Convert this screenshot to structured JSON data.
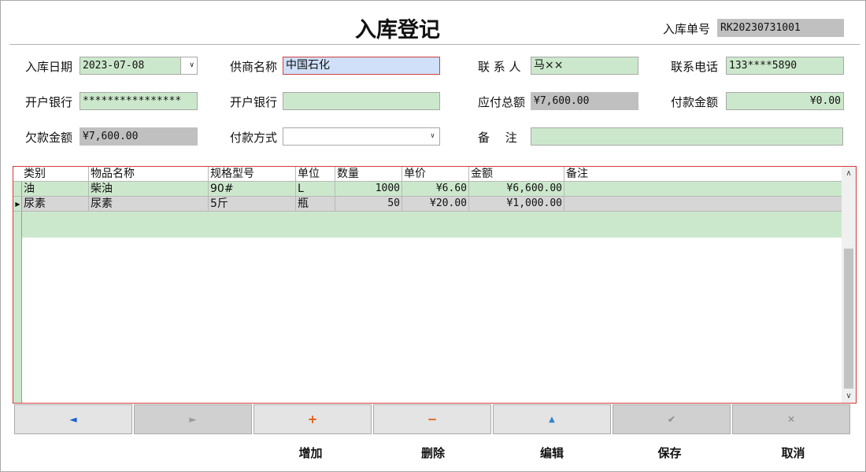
{
  "form": {
    "title": "入库登记",
    "order_no_label": "入库单号",
    "order_no": "RK20230731001",
    "date_label": "入库日期",
    "date_value": "2023-07-08",
    "supplier_label": "供商名称",
    "supplier_value": "中国石化",
    "contact_label": "联 系 人",
    "contact_value": "马××",
    "phone_label": "联系电话",
    "phone_value": "133****5890",
    "bank_account_label": "开户银行",
    "bank_account_value": "****************",
    "bank_label": "开户银行",
    "bank_value": "",
    "payable_label": "应付总额",
    "payable_value": "¥7,600.00",
    "paid_label": "付款金额",
    "paid_value": "¥0.00",
    "debt_label": "欠款金额",
    "debt_value": "¥7,600.00",
    "pay_method_label": "付款方式",
    "pay_method_value": "",
    "remark_label": "备　 注",
    "remark_value": ""
  },
  "table": {
    "columns": [
      "类别",
      "物品名称",
      "规格型号",
      "单位",
      "数量",
      "单价",
      "金额",
      "备注"
    ],
    "rows": [
      [
        "油",
        "柴油",
        "90#",
        "L",
        "1000",
        "¥6.60",
        "¥6,600.00",
        ""
      ],
      [
        "尿素",
        "尿素",
        "5斤",
        "瓶",
        "50",
        "¥20.00",
        "¥1,000.00",
        ""
      ]
    ],
    "current_row_index": 1
  },
  "toolbar": {
    "buttons": [
      {
        "label": "",
        "icon": "prev-arrow-icon",
        "glyph": "◄",
        "color": "#1a5fcc"
      },
      {
        "label": "",
        "icon": "next-arrow-icon",
        "glyph": "►",
        "color": "#9a9a9a"
      },
      {
        "label": "增加",
        "icon": "plus-icon",
        "glyph": "+",
        "color": "#e05a10"
      },
      {
        "label": "删除",
        "icon": "minus-icon",
        "glyph": "−",
        "color": "#e05a10"
      },
      {
        "label": "编辑",
        "icon": "edit-up-icon",
        "glyph": "▲",
        "color": "#2e86c8"
      },
      {
        "label": "保存",
        "icon": "check-icon",
        "glyph": "✔",
        "color": "#8a8a8a"
      },
      {
        "label": "取消",
        "icon": "x-icon",
        "glyph": "✕",
        "color": "#8a8a8a"
      }
    ]
  },
  "colors": {
    "editable_field": "#cce8cc",
    "readonly_field": "#c0c0c0",
    "focused_field": "#cfe0f8",
    "grid_border": "#d23a3a"
  }
}
